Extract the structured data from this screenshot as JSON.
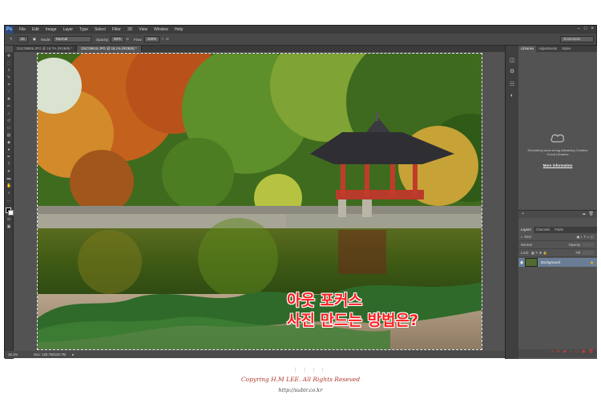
{
  "app": {
    "logo": "Ps"
  },
  "menu": [
    "File",
    "Edit",
    "Image",
    "Layer",
    "Type",
    "Select",
    "Filter",
    "3D",
    "View",
    "Window",
    "Help"
  ],
  "window_buttons": [
    "–",
    "□",
    "×"
  ],
  "options_bar": {
    "size_value": "25",
    "mode_label": "Mode:",
    "mode_value": "Normal",
    "opacity_label": "Opacity:",
    "opacity_value": "50%",
    "flow_label": "Flow:",
    "flow_value": "100%",
    "workspace": "Essentials"
  },
  "doc_tabs": [
    {
      "label": "DSC09906.JPG @ 16.7% (RGB/8) *",
      "active": false
    },
    {
      "label": "DSC09619.JPG @ 18.1% (RGB/8) *",
      "active": true
    }
  ],
  "status": {
    "zoom": "18.1%",
    "doc": "Doc: 120.7M/120.7M"
  },
  "panels": {
    "top_tabs": [
      "Libraries",
      "Adjustments",
      "Styles"
    ],
    "library_message": "Something went wrong initializing Creative Cloud Libraries",
    "more_info": "More information",
    "layer_tabs": [
      "Layers",
      "Channels",
      "Paths"
    ],
    "kind_label": "Kind",
    "blend_mode": "Normal",
    "opacity_label": "Opacity:",
    "lock_label": "Lock:",
    "fill_label": "Fill:",
    "layer_name": "Background"
  },
  "overlay": {
    "line1": "아웃 포커스",
    "line2": "사진 만드는 방법은?"
  },
  "footer": {
    "dots": "| | | |",
    "copyright": "Copyring H.M LEE. All Rights Reseved",
    "url": "http://subir.co.kr"
  },
  "colors": {
    "overlay_text": "#ff1e1e",
    "copyright": "#b03a2e",
    "selected_layer": "#6a7d95"
  }
}
